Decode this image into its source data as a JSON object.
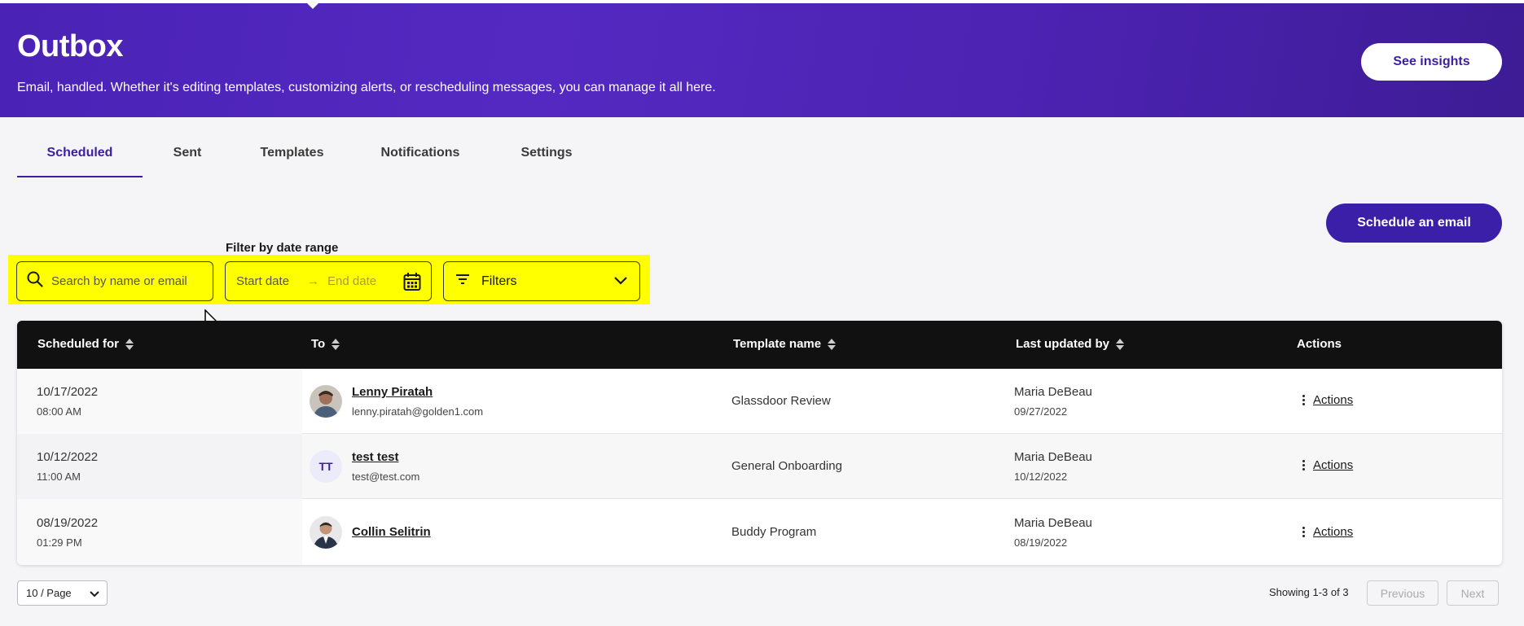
{
  "header": {
    "title": "Outbox",
    "subtitle": "Email, handled. Whether it's editing templates, customizing alerts, or rescheduling messages, you can manage it all here.",
    "insights_label": "See insights",
    "bg_color": "#4a22b5"
  },
  "tabs": [
    {
      "label": "Scheduled",
      "active": true
    },
    {
      "label": "Sent",
      "active": false
    },
    {
      "label": "Templates",
      "active": false
    },
    {
      "label": "Notifications",
      "active": false
    },
    {
      "label": "Settings",
      "active": false
    }
  ],
  "schedule_label": "Schedule an email",
  "filters": {
    "date_range_label": "Filter by date range",
    "search_placeholder": "Search by name or email",
    "start_date_placeholder": "Start date",
    "end_date_placeholder": "End date",
    "filters_label": "Filters",
    "highlight_color": "#ffff00"
  },
  "table": {
    "columns": [
      "Scheduled for",
      "To",
      "Template name",
      "Last updated by",
      "Actions"
    ],
    "rows": [
      {
        "date": "10/17/2022",
        "time": "08:00 AM",
        "to_name": "Lenny Piratah",
        "to_email": "lenny.piratah@golden1.com",
        "avatar": "photo",
        "template": "Glassdoor Review",
        "updated_by": "Maria DeBeau",
        "updated_date": "09/27/2022",
        "action_label": "Actions"
      },
      {
        "date": "10/12/2022",
        "time": "11:00 AM",
        "to_name": "test test",
        "to_email": "test@test.com",
        "avatar": "TT",
        "template": "General Onboarding",
        "updated_by": "Maria DeBeau",
        "updated_date": "10/12/2022",
        "action_label": "Actions"
      },
      {
        "date": "08/19/2022",
        "time": "01:29 PM",
        "to_name": "Collin Selitrin",
        "to_email": "",
        "avatar": "photo",
        "template": "Buddy Program",
        "updated_by": "Maria DeBeau",
        "updated_date": "08/19/2022",
        "action_label": "Actions"
      }
    ]
  },
  "pagination": {
    "page_size": "10 / Page",
    "showing": "Showing 1-3 of 3",
    "previous_label": "Previous",
    "next_label": "Next"
  }
}
